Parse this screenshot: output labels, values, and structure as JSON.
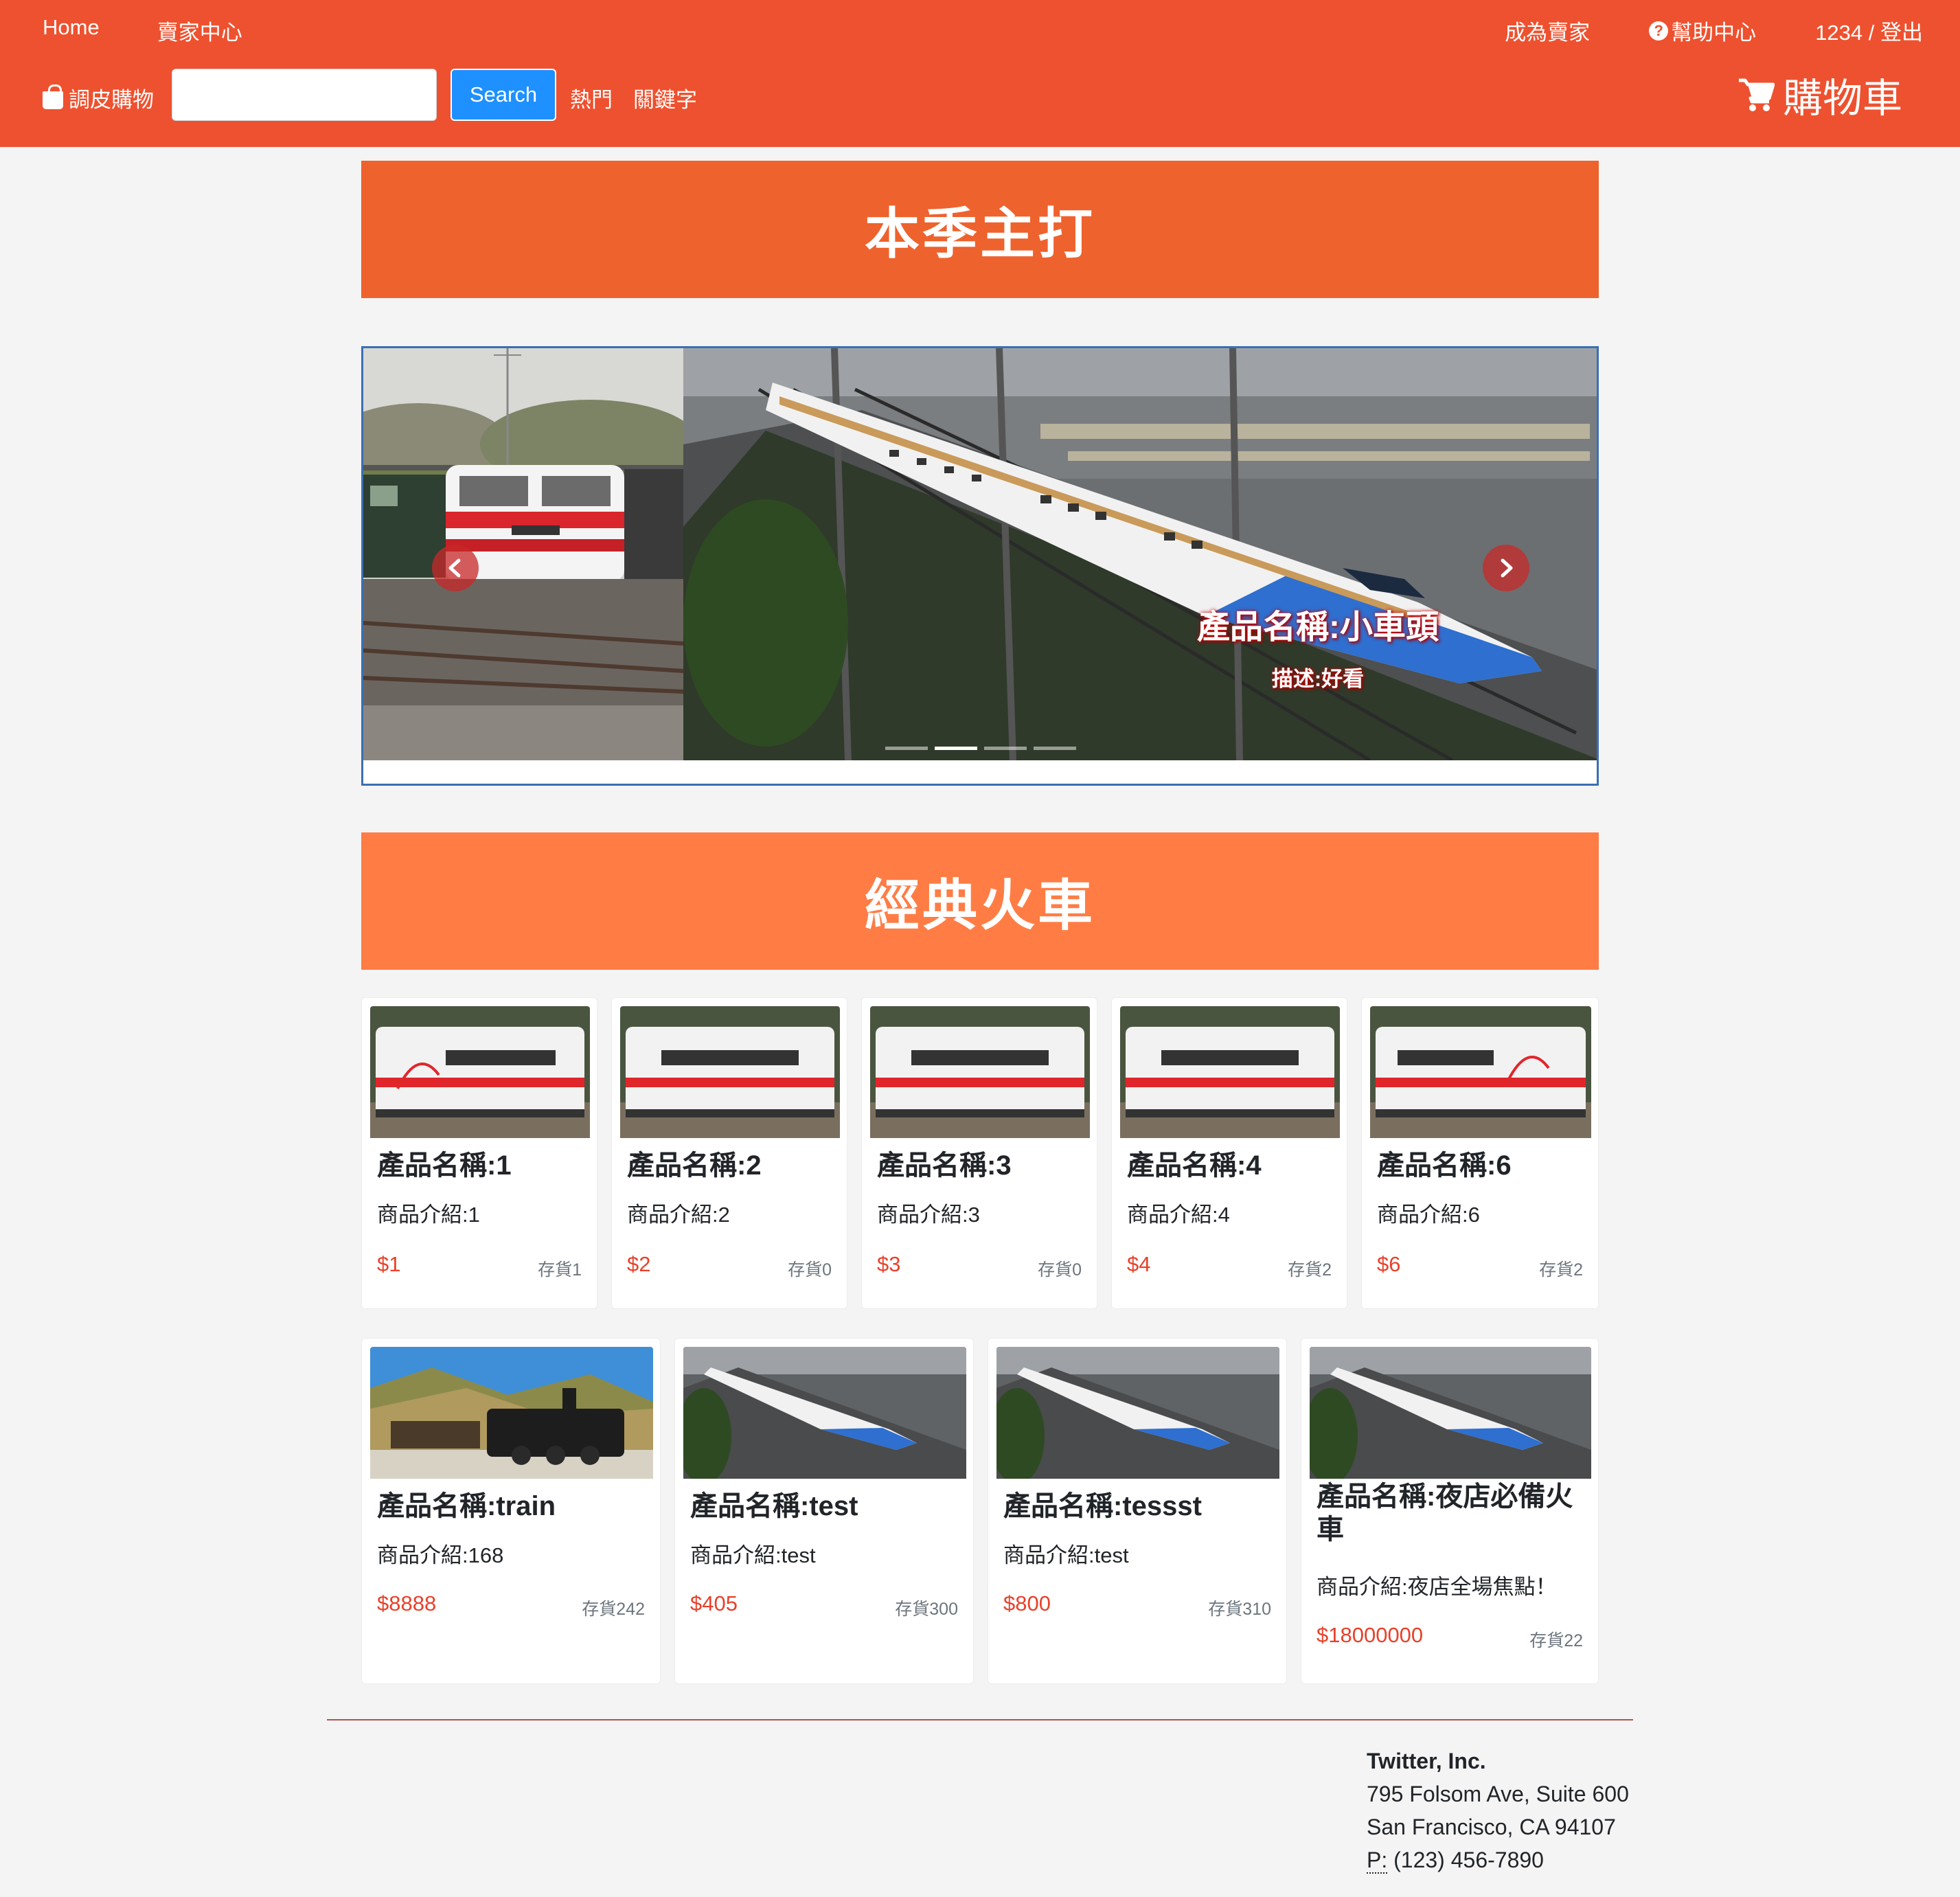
{
  "nav": {
    "home": "Home",
    "seller_center": "賣家中心",
    "become_seller": "成為賣家",
    "help_center": "幫助中心",
    "user_logout": "1234 / 登出",
    "brand": "調皮購物",
    "search_placeholder": "",
    "search_button": "Search",
    "hot": "熱門",
    "keyword": "關鍵字",
    "cart": "購物車"
  },
  "sections": {
    "featured_title": "本季主打",
    "classic_title": "經典火車"
  },
  "carousel": {
    "caption_title": "產品名稱:小車頭",
    "caption_desc": "描述:好看",
    "slide_count": 4,
    "active_index": 1
  },
  "products_row1": [
    {
      "name": "產品名稱:1",
      "intro": "商品介紹:1",
      "price": "$1",
      "stock": "存貨1"
    },
    {
      "name": "產品名稱:2",
      "intro": "商品介紹:2",
      "price": "$2",
      "stock": "存貨0"
    },
    {
      "name": "產品名稱:3",
      "intro": "商品介紹:3",
      "price": "$3",
      "stock": "存貨0"
    },
    {
      "name": "產品名稱:4",
      "intro": "商品介紹:4",
      "price": "$4",
      "stock": "存貨2"
    },
    {
      "name": "產品名稱:6",
      "intro": "商品介紹:6",
      "price": "$6",
      "stock": "存貨2"
    }
  ],
  "products_row2": [
    {
      "name": "產品名稱:train",
      "intro": "商品介紹:168",
      "price": "$8888",
      "stock": "存貨242"
    },
    {
      "name": "產品名稱:test",
      "intro": "商品介紹:test",
      "price": "$405",
      "stock": "存貨300"
    },
    {
      "name": "產品名稱:tessst",
      "intro": "商品介紹:test",
      "price": "$800",
      "stock": "存貨310"
    },
    {
      "name": "產品名稱:夜店必備火車",
      "intro": "商品介紹:夜店全場焦點！",
      "price": "$18000000",
      "stock": "存貨22"
    }
  ],
  "footer": {
    "company": "Twitter, Inc.",
    "street": "795 Folsom Ave, Suite 600",
    "city": "San Francisco, CA 94107",
    "phone_label": "P:",
    "phone": "(123) 456-7890"
  },
  "colors": {
    "navbar": "#ee512f",
    "featured_banner": "#ee622d",
    "classic_banner": "#ff7d45",
    "price": "#e8412b",
    "search_button": "#1e90ff"
  }
}
